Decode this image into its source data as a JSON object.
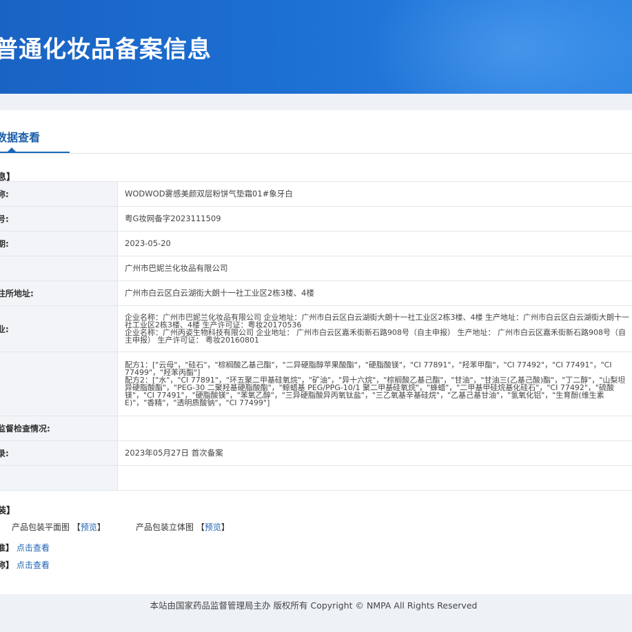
{
  "header": {
    "title": "普通化妆品备案信息"
  },
  "tabs": [
    {
      "label": "数据查看"
    }
  ],
  "sections": {
    "basic": "息】",
    "package": "装】"
  },
  "rows": [
    {
      "label": "称:",
      "value": "WODWOD雾感美颜双层粉饼气垫霜01#象牙白"
    },
    {
      "label": "号:",
      "value": "粤G妆网备字2023111509"
    },
    {
      "label": "期:",
      "value": "2023-05-20"
    },
    {
      "label": "",
      "value": "广州市巴妮兰化妆品有限公司"
    },
    {
      "label": "住所地址:",
      "value": "广州市白云区白云湖街大朗十一社工业区2栋3楼、4楼"
    },
    {
      "label": "业:",
      "value": "企业名称：广州市巴妮兰化妆品有限公司 企业地址：广州市白云区白云湖街大朗十一社工业区2栋3楼、4楼 生产地址：广州市白云区白云湖街大朗十一社工业区2栋3楼、4楼 生产许可证：粤妆20170536\n企业名称：广州丙姿生物科技有限公司 企业地址： 广州市白云区嘉禾街新石路908号（自主申报） 生产地址： 广州市白云区嘉禾街新石路908号（自主申报） 生产许可证： 粤妆20160801"
    },
    {
      "label": "",
      "value": "配方1：[\"云母\"，\"硅石\"，\"棕榈酸乙基己酯\"，\"二异硬脂醇苹果酸酯\"，\"硬脂酸镁\"，\"CI 77891\"，\"羟苯甲酯\"，\"CI 77492\"，\"CI 77491\"，\"CI 77499\"，\"羟苯丙酯\"]\n配方2：[\"水\"，\"CI 77891\"，\"环五聚二甲基硅氧烷\"，\"矿油\"，\"异十六烷\"，\"棕榈酸乙基己酯\"，\"甘油\"，\"甘油三(乙基己酸)酯\"，\"丁二醇\"，\"山梨坦异硬脂酸酯\"，\"PEG-30 二聚羟基硬脂酸酯\"，\"鲸蜡基 PEG/PPG-10/1 聚二甲基硅氧烷\"，\"蜂蜡\"，\"二甲基甲硅烷基化硅石\"，\"CI 77492\"，\"硫酸镁\"，\"CI 77491\"，\"硬脂酸镁\"，\"苯氧乙醇\"，\"三异硬脂酸异丙氧钛盐\"，\"三乙氧基辛基硅烷\"，\"乙基己基甘油\"，\"氢氧化铝\"，\"生育酚(维生素E)\"，\"香精\"，\"透明质酸钠\"，\"CI 77499\"]"
    },
    {
      "label": "监督检查情况:",
      "value": ""
    },
    {
      "label": "录:",
      "value": "2023年05月27日 首次备案"
    },
    {
      "label": "",
      "value": ""
    }
  ],
  "package": {
    "flat_label": "产品包装平面图",
    "solid_label": "产品包装立体图",
    "preview": "预览",
    "bracket_open": "【",
    "bracket_close": "】"
  },
  "links": [
    {
      "label": "准】",
      "link": "点击查看"
    },
    {
      "label": "称】",
      "link": "点击查看"
    }
  ],
  "footer": {
    "text": "本站由国家药品监督管理局主办 版权所有 Copyright © NMPA All Rights Reserved"
  }
}
